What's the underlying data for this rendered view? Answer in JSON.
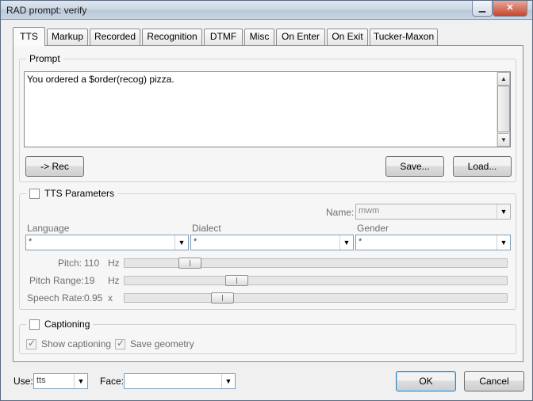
{
  "window": {
    "title": "RAD prompt: verify"
  },
  "tabs": [
    "TTS",
    "Markup",
    "Recorded",
    "Recognition",
    "DTMF",
    "Misc",
    "On Enter",
    "On Exit",
    "Tucker-Maxon"
  ],
  "prompt": {
    "group_label": "Prompt",
    "text": "You ordered a $order(recog) pizza.",
    "rec_button": "-> Rec",
    "save_button": "Save...",
    "load_button": "Load..."
  },
  "tts_params": {
    "group_label": "TTS Parameters",
    "checked": false,
    "name_label": "Name:",
    "name_value": "mwm",
    "language_label": "Language",
    "language_value": "*",
    "dialect_label": "Dialect",
    "dialect_value": "*",
    "gender_label": "Gender",
    "gender_value": "*",
    "pitch_label": "Pitch:",
    "pitch_value": "110",
    "pitch_unit": "Hz",
    "pitch_level": 0.15,
    "pitch_range_label": "Pitch Range:",
    "pitch_range_value": "19",
    "pitch_range_unit": "Hz",
    "pitch_range_level": 0.28,
    "speech_rate_label": "Speech Rate:",
    "speech_rate_value": "0.95",
    "speech_rate_unit": "x",
    "speech_rate_level": 0.24
  },
  "captioning": {
    "group_label": "Captioning",
    "checked": false,
    "show_captioning": "Show captioning",
    "save_geometry": "Save geometry"
  },
  "footer": {
    "use_label": "Use:",
    "use_value": "tts",
    "face_label": "Face:",
    "face_value": "",
    "ok_button": "OK",
    "cancel_button": "Cancel"
  }
}
